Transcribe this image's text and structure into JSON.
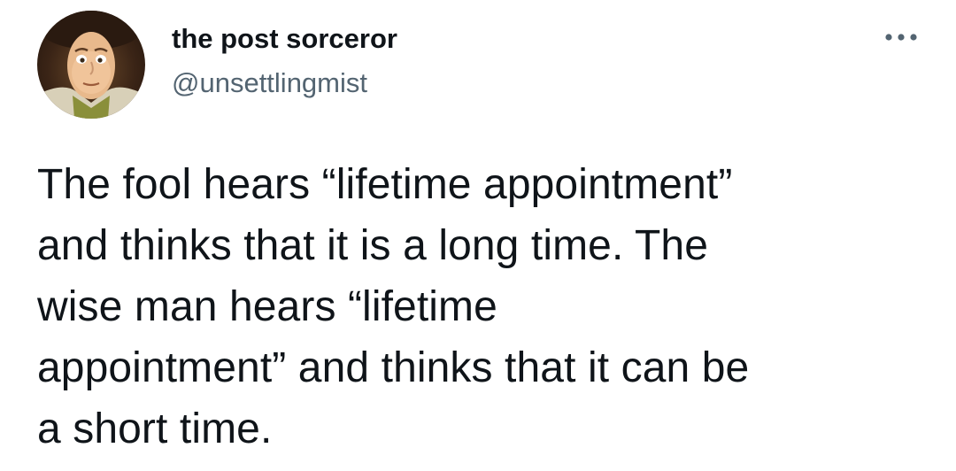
{
  "author": {
    "display_name": "the post sorceror",
    "handle": "@unsettlingmist",
    "avatar_icon": "avatar-cartoon-face"
  },
  "menu": {
    "icon": "more-options-icon"
  },
  "tweet": {
    "text": "The fool hears “lifetime appointment”\nand thinks that it is a long time. The\nwise man hears “lifetime\nappointment” and thinks that it can be\na short time."
  },
  "colors": {
    "text": "#0f1419",
    "secondary": "#536471",
    "background": "#ffffff"
  }
}
